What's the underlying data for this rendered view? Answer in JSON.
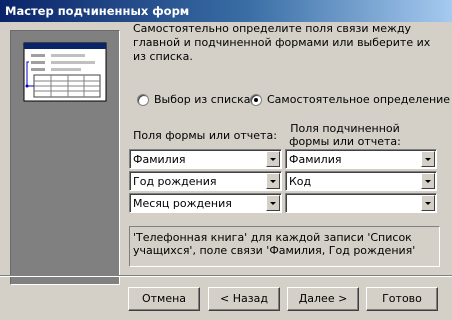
{
  "window": {
    "title": "Мастер подчиненных форм"
  },
  "description": "Самостоятельно определите поля связи между главной и подчиненной формами или выберите их из списка.",
  "radio_options": {
    "from_list": {
      "label": "Выбор из списка",
      "selected": false
    },
    "custom": {
      "label": "Самостоятельное определение",
      "selected": true
    }
  },
  "columns": {
    "main_label": "Поля формы или отчета:",
    "sub_label": "Поля подчиненной формы или отчета:"
  },
  "field_pairs": [
    {
      "main": "Фамилия",
      "sub": "Фамилия"
    },
    {
      "main": "Год рождения",
      "sub": "Код"
    },
    {
      "main": "Месяц рождения",
      "sub": ""
    }
  ],
  "summary": "'Телефонная книга' для каждой записи 'Список учащихся', поле связи 'Фамилия, Год рождения'",
  "buttons": {
    "cancel": "Отмена",
    "back": "< Назад",
    "next": "Далее >",
    "finish": "Готово"
  }
}
